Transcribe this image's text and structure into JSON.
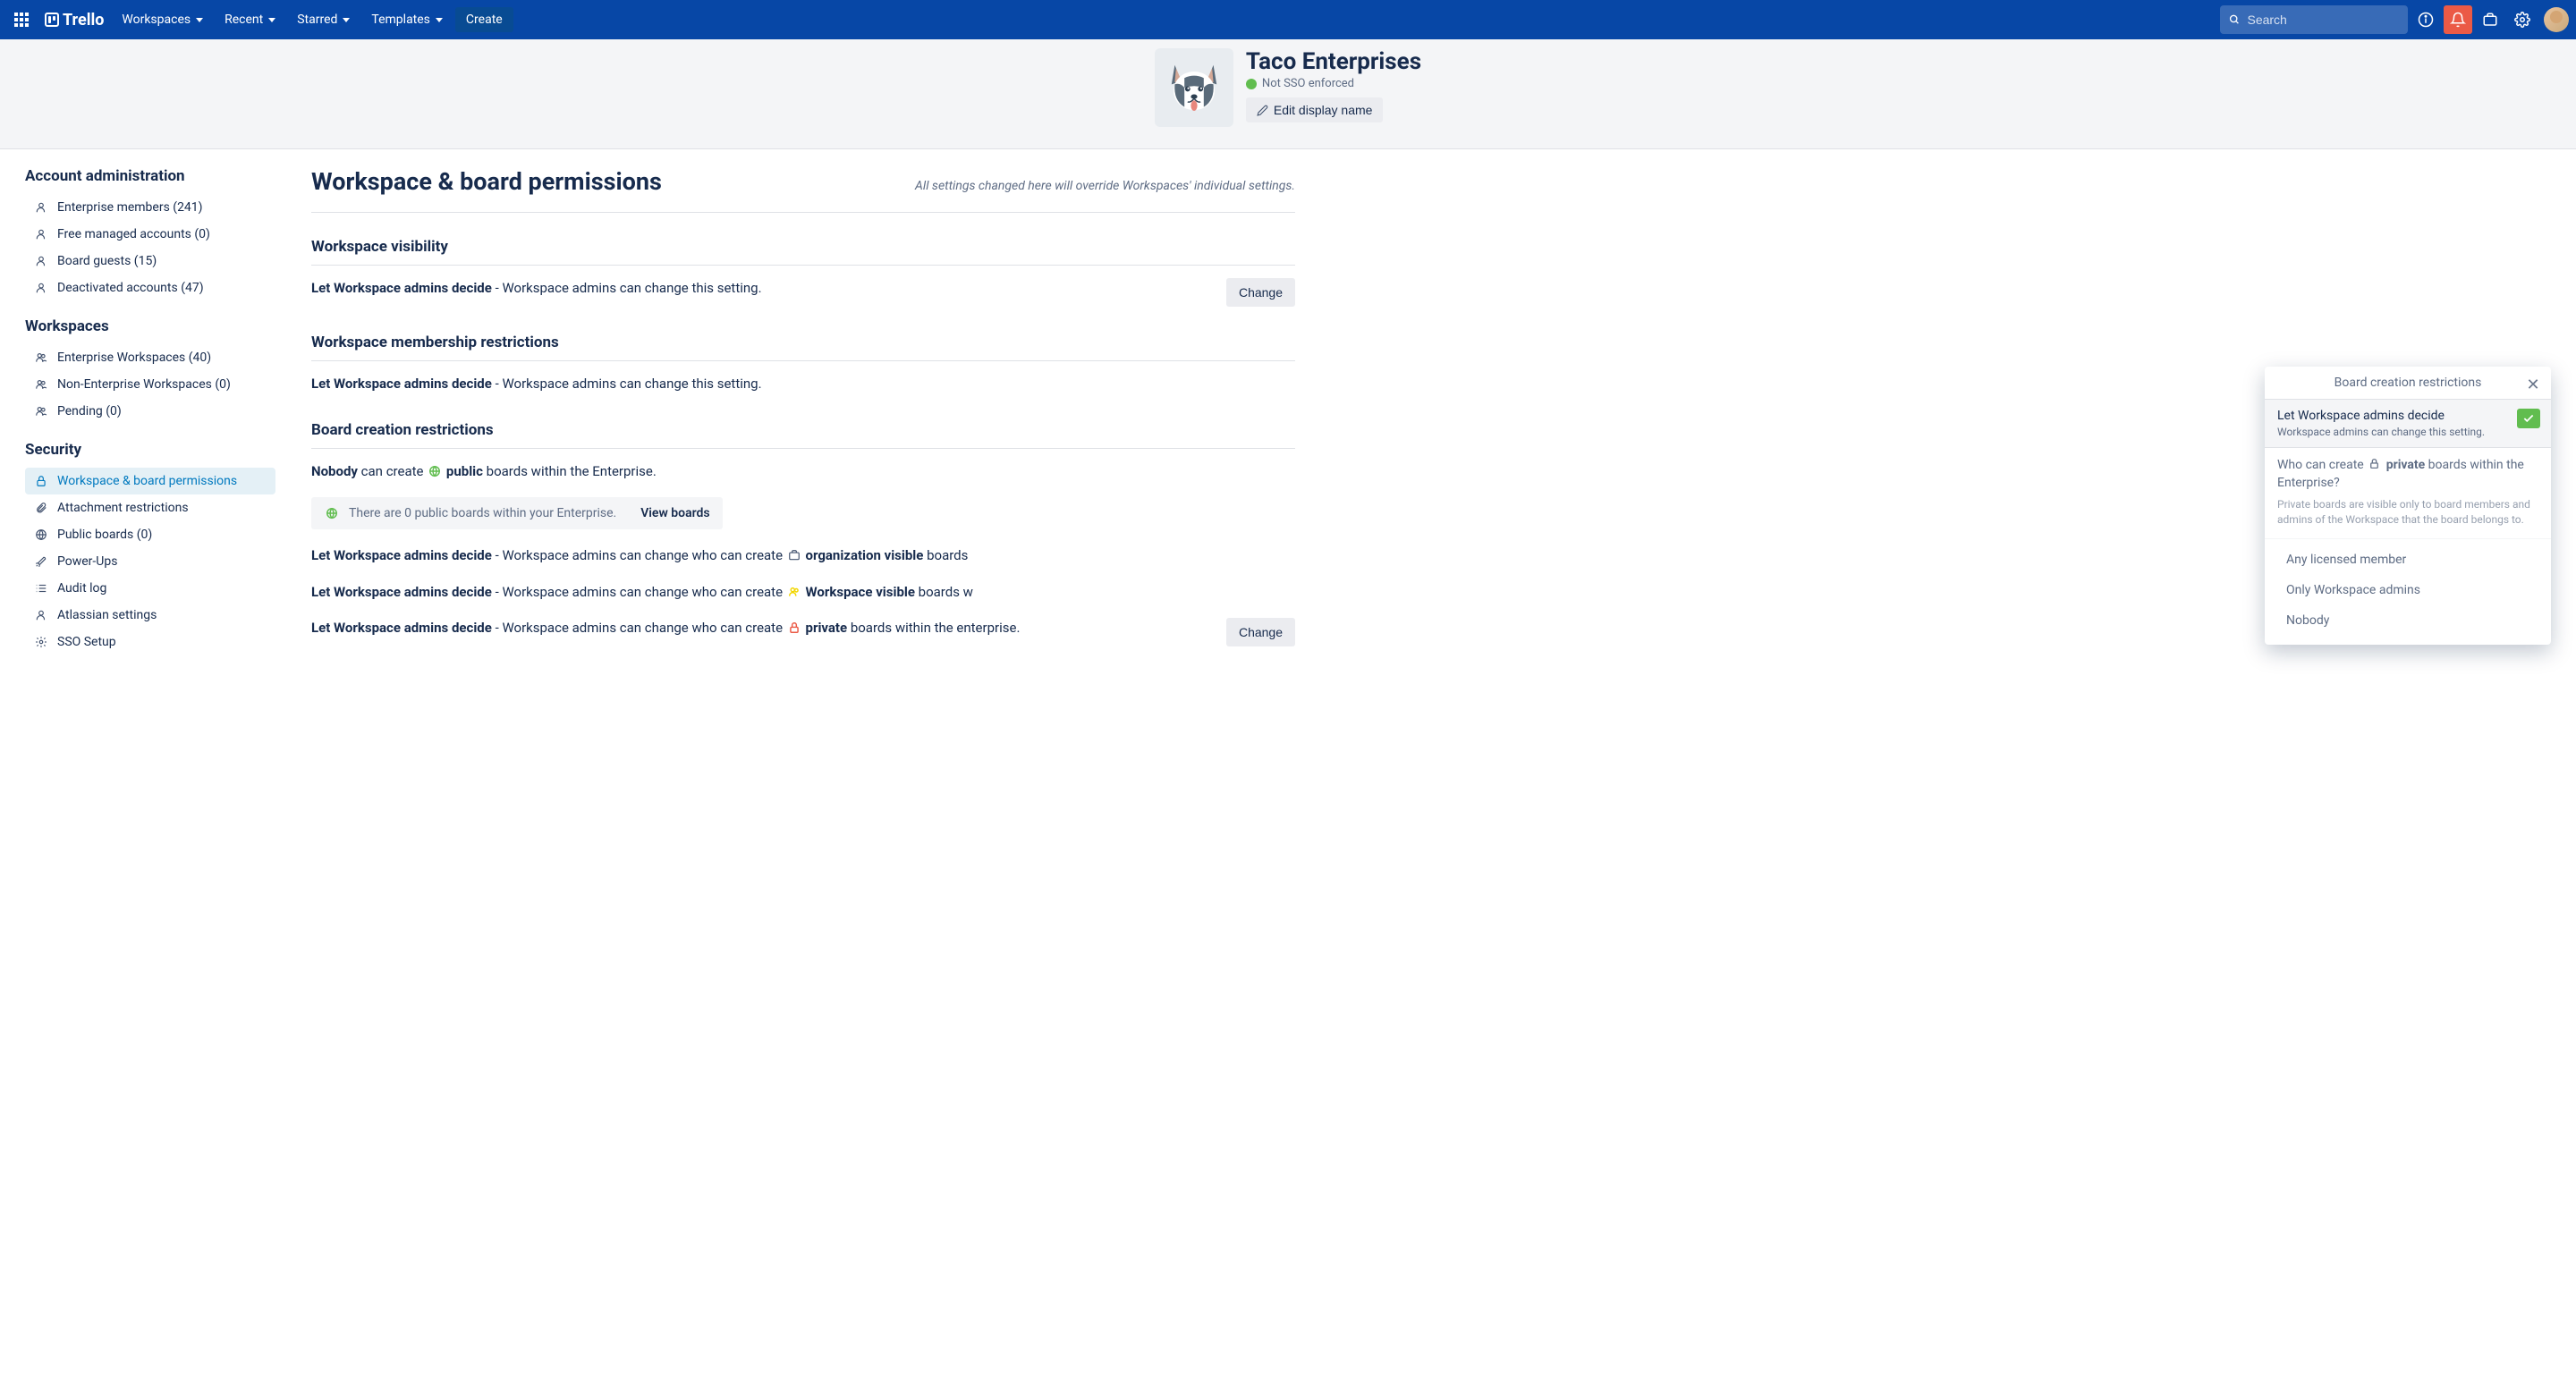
{
  "nav": {
    "brand": "Trello",
    "workspaces": "Workspaces",
    "recent": "Recent",
    "starred": "Starred",
    "templates": "Templates",
    "create": "Create",
    "search_placeholder": "Search"
  },
  "header": {
    "org_name": "Taco Enterprises",
    "sso_status": "Not SSO enforced",
    "edit_button": "Edit display name"
  },
  "sidebar": {
    "section_account": "Account administration",
    "enterprise_members": "Enterprise members (241)",
    "free_managed": "Free managed accounts (0)",
    "board_guests": "Board guests (15)",
    "deactivated": "Deactivated accounts (47)",
    "section_workspaces": "Workspaces",
    "enterprise_ws": "Enterprise Workspaces (40)",
    "non_enterprise_ws": "Non-Enterprise Workspaces (0)",
    "pending": "Pending (0)",
    "section_security": "Security",
    "ws_board_perms": "Workspace & board permissions",
    "attachment": "Attachment restrictions",
    "public_boards": "Public boards (0)",
    "powerups": "Power-Ups",
    "audit_log": "Audit log",
    "atlassian": "Atlassian settings",
    "sso_setup": "SSO Setup"
  },
  "page": {
    "title": "Workspace & board permissions",
    "note": "All settings changed here will override Workspaces' individual settings.",
    "change": "Change",
    "ws_visibility_h": "Workspace visibility",
    "ws_visibility_strong": "Let Workspace admins decide",
    "ws_visibility_rest": " - Workspace admins can change this setting.",
    "ws_membership_h": "Workspace membership restrictions",
    "ws_membership_strong": "Let Workspace admins decide",
    "ws_membership_rest": " - Workspace admins can change this setting.",
    "board_creation_h": "Board creation restrictions",
    "bc_public_strong1": "Nobody",
    "bc_public_mid": " can create ",
    "bc_public_strong2": "public",
    "bc_public_rest": " boards within the Enterprise.",
    "info_text": "There are 0 public boards within your Enterprise.",
    "info_link": "View boards",
    "bc_org_strong": "Let Workspace admins decide",
    "bc_org_mid": " - Workspace admins can change who can create ",
    "bc_org_bold": "organization visible",
    "bc_org_rest": " boards",
    "bc_wsv_strong": "Let Workspace admins decide",
    "bc_wsv_mid": " - Workspace admins can change who can create ",
    "bc_wsv_bold": "Workspace visible",
    "bc_wsv_rest": " boards w",
    "bc_priv_strong": "Let Workspace admins decide",
    "bc_priv_mid": " - Workspace admins can change who can create ",
    "bc_priv_bold": "private",
    "bc_priv_rest": " boards within the enterprise."
  },
  "popover": {
    "title": "Board creation restrictions",
    "opt_title": "Let Workspace admins decide",
    "opt_sub": "Workspace admins can change this setting.",
    "q_pre": "Who can create ",
    "q_bold": "private",
    "q_post": " boards within the Enterprise?",
    "help": "Private boards are visible only to board members and admins of the Workspace that the board belongs to.",
    "o1": "Any licensed member",
    "o2": "Only Workspace admins",
    "o3": "Nobody"
  }
}
